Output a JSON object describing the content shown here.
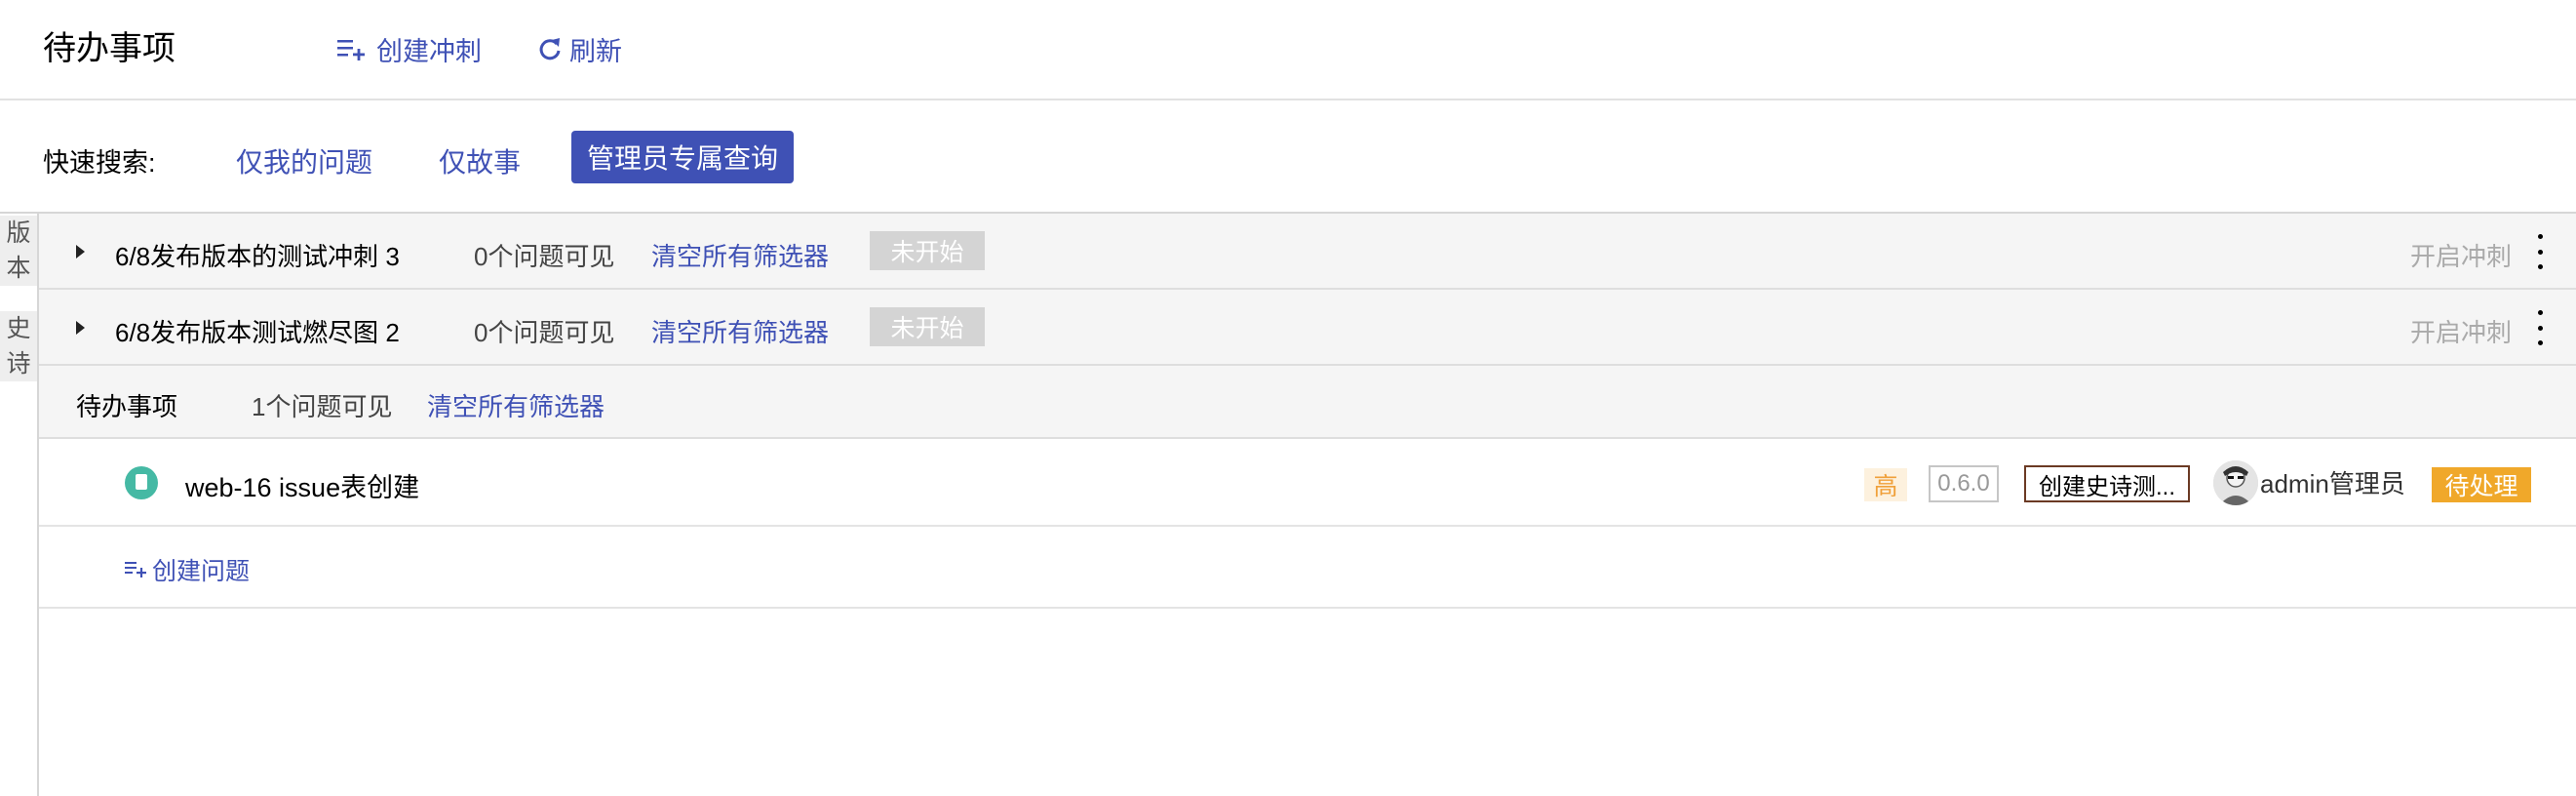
{
  "header": {
    "title": "待办事项",
    "create_sprint_label": "创建冲刺",
    "refresh_label": "刷新"
  },
  "quick_search": {
    "label": "快速搜索:",
    "filters": [
      "仅我的问题",
      "仅故事",
      "管理员专属查询"
    ],
    "active_filter": "管理员专属查询"
  },
  "side_tabs": [
    {
      "label_line1": "版",
      "label_line2": "本"
    },
    {
      "label_line1": "史",
      "label_line2": "诗"
    }
  ],
  "sprints": [
    {
      "name": "6/8发布版本的测试冲刺 3",
      "count": "0个问题可见",
      "clear": "清空所有筛选器",
      "status": "未开始",
      "action": "开启冲刺"
    },
    {
      "name": "6/8发布版本测试燃尽图 2",
      "count": "0个问题可见",
      "clear": "清空所有筛选器",
      "status": "未开始",
      "action": "开启冲刺"
    }
  ],
  "backlog": {
    "name": "待办事项",
    "count": "1个问题可见",
    "clear": "清空所有筛选器",
    "create_issue_label": "创建问题"
  },
  "issue": {
    "key_summary": "web-16 issue表创建",
    "priority": "高",
    "version": "0.6.0",
    "epic": "创建史诗测...",
    "assignee": "admin管理员",
    "status": "待处理",
    "type_icon": "story-icon"
  },
  "colors": {
    "accent": "#3f51b5",
    "status_pending": "#f0a82a",
    "status_not_started": "#d4d4d4",
    "priority_high": "#f0a03a",
    "issue_type": "#45b9a4"
  }
}
